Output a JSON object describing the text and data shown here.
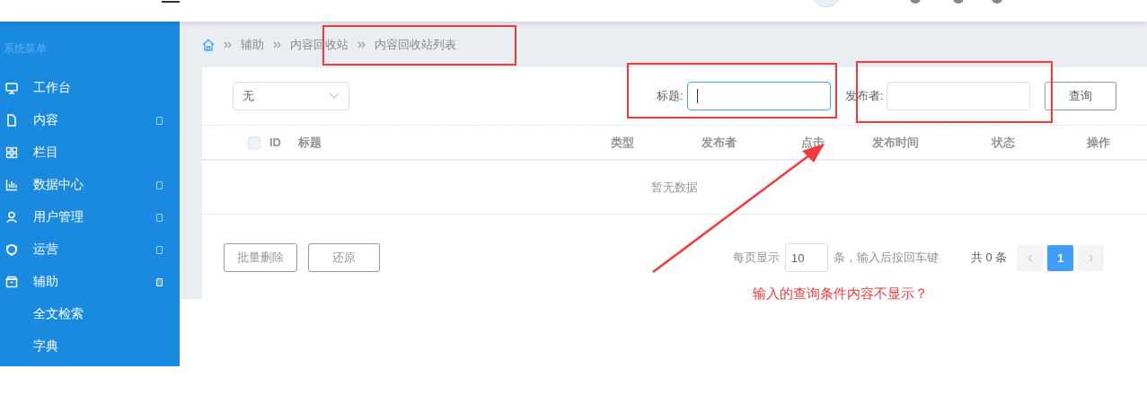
{
  "sidebar": {
    "heading": "系统菜单",
    "items": [
      {
        "label": "工作台"
      },
      {
        "label": "内容",
        "expanded": false
      },
      {
        "label": "栏目"
      },
      {
        "label": "数据中心",
        "expanded": false
      },
      {
        "label": "用户管理",
        "expanded": false
      },
      {
        "label": "运营",
        "expanded": false
      },
      {
        "label": "辅助",
        "expanded": true,
        "children": [
          {
            "label": "全文检索"
          },
          {
            "label": "字典"
          }
        ]
      }
    ]
  },
  "breadcrumb": [
    "辅助",
    "内容回收站",
    "内容回收站列表"
  ],
  "filter": {
    "select_value": "无",
    "fields": [
      {
        "label": "标题:",
        "focused": true
      },
      {
        "label": "发布者:",
        "focused": false
      }
    ],
    "button": "查询"
  },
  "table": {
    "select_all_checked": false,
    "columns": [
      "ID",
      "标题",
      "类型",
      "发布者",
      "点击",
      "发布时间",
      "状态",
      "操作"
    ],
    "empty_text": "暂无数据"
  },
  "actions": [
    "批量删除",
    "还原"
  ],
  "pagination": {
    "per_page_label": "每页显示",
    "per_page_value": "10",
    "per_page_hint": "条，输入后按回车键",
    "total": "共 0 条",
    "prev": "‹",
    "next": "›",
    "pages": [
      {
        "label": "1",
        "selected": true
      }
    ]
  },
  "annotation": {
    "text": "输入的查询条件内容不显示？"
  }
}
